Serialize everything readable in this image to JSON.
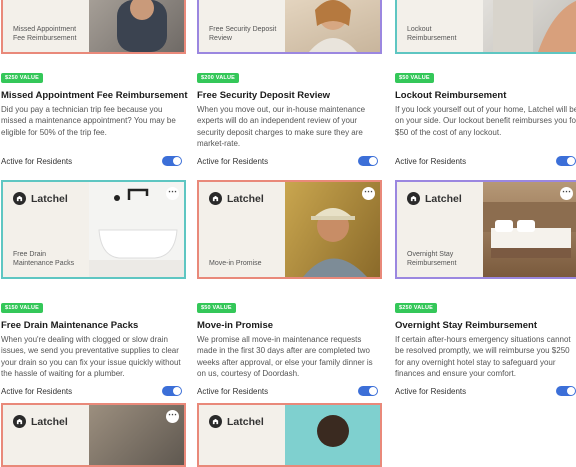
{
  "brand": {
    "name": "Latchel"
  },
  "colors": {
    "salmon": "#e9897a",
    "purple": "#9b87e0",
    "teal": "#5ec6c2",
    "badge_green": "#34c759",
    "toggle_blue": "#3c6fd8"
  },
  "cards": [
    {
      "thumb_caption": "Missed Appointment Fee Reimbursement",
      "badge": "$250 VALUE",
      "title": "Missed Appointment Fee Reimbursement",
      "desc": "Did you pay a technician trip fee because you missed a maintenance appointment? You may be eligible for 50% of the trip fee.",
      "status": "Active for Residents"
    },
    {
      "thumb_caption": "Free Security Deposit Review",
      "badge": "$200 VALUE",
      "title": "Free Security Deposit Review",
      "desc": "When you move out, our in-house maintenance experts will do an independent review of your security deposit charges to make sure they are market-rate.",
      "status": "Active for Residents"
    },
    {
      "thumb_caption": "Lockout Reimbursement",
      "badge": "$50 VALUE",
      "title": "Lockout Reimbursement",
      "desc": "If you lock yourself out of your home, Latchel will be on your side. Our lockout benefit reimburses you for $50 of the cost of any lockout.",
      "status": "Active for Residents"
    },
    {
      "thumb_caption": "Free Drain Maintenance Packs",
      "badge": "$150 VALUE",
      "title": "Free Drain Maintenance Packs",
      "desc": "When you're dealing with clogged or slow drain issues, we send you preventative supplies to clear your drain so you can fix your issue quickly without the hassle of waiting for a plumber.",
      "status": "Active for Residents"
    },
    {
      "thumb_caption": "Move-in Promise",
      "badge": "$50 VALUE",
      "title": "Move-in Promise",
      "desc": "We promise all move-in maintenance requests made in the first 30 days after are completed two weeks after approval, or else your family dinner is on us, courtesy of Doordash.",
      "status": "Active for Residents"
    },
    {
      "thumb_caption": "Overnight Stay Reimbursement",
      "badge": "$250 VALUE",
      "title": "Overnight Stay Reimbursement",
      "desc": "If certain after-hours emergency situations cannot be resolved promptly, we will reimburse you $250 for any overnight hotel stay to safeguard your finances and ensure your comfort.",
      "status": "Active for Residents"
    }
  ],
  "icons": {
    "more": "more-options-icon",
    "logo": "latchel-logo-icon",
    "toggle": "toggle-switch"
  }
}
